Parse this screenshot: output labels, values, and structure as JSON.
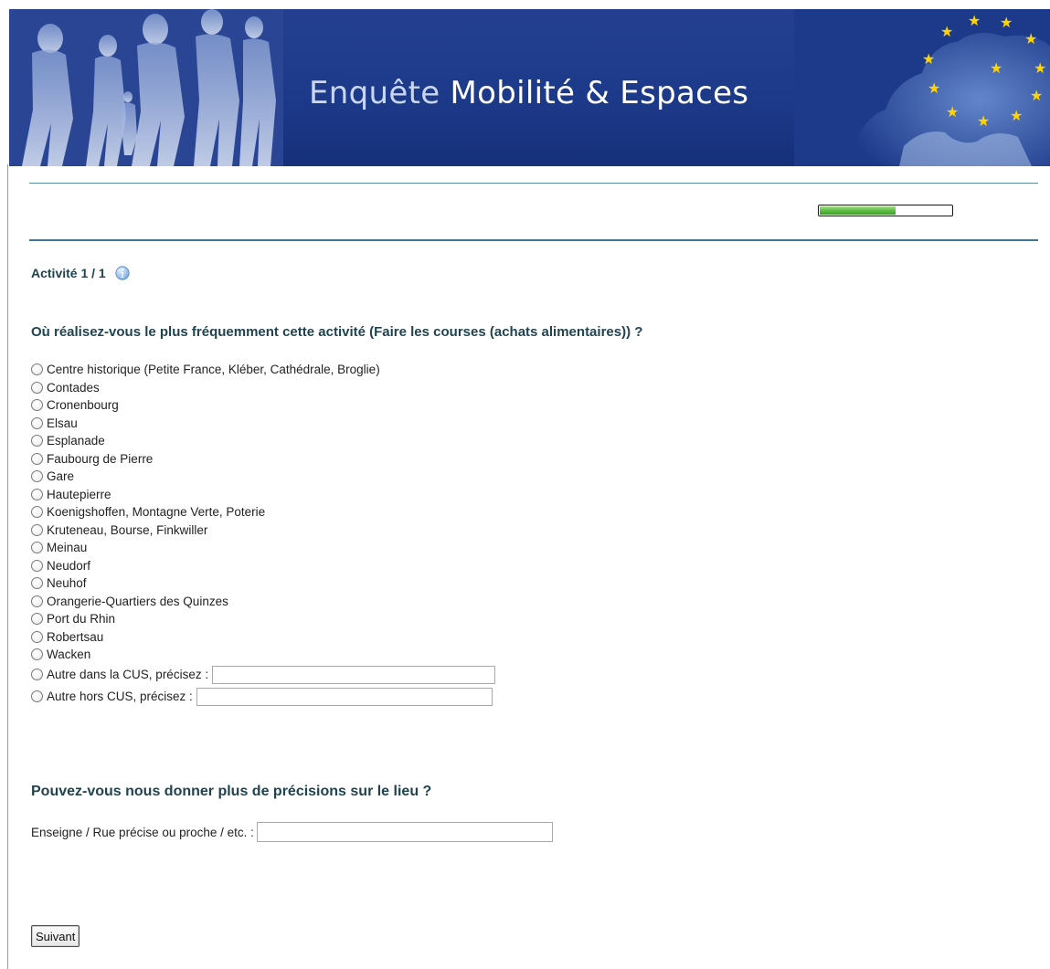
{
  "banner": {
    "title_prefix": "Enquête ",
    "title_main": "Mobilité & Espaces"
  },
  "progress": {
    "fraction": 0.58,
    "fill_color": "#5fbd45"
  },
  "activity": {
    "label": "Activité 1 / 1",
    "help_icon": "info-icon"
  },
  "question1": {
    "text": "Où réalisez-vous le plus fréquemment cette activité (Faire les courses (achats alimentaires)) ?",
    "options": [
      "Centre historique (Petite France, Kléber, Cathédrale, Broglie)",
      "Contades",
      "Cronenbourg",
      "Elsau",
      "Esplanade",
      "Faubourg de Pierre",
      "Gare",
      "Hautepierre",
      "Koenigshoffen, Montagne Verte, Poterie",
      "Kruteneau, Bourse, Finkwiller",
      "Meinau",
      "Neudorf",
      "Neuhof",
      "Orangerie-Quartiers des Quinzes",
      "Port du Rhin",
      "Robertsau",
      "Wacken"
    ],
    "other_options": [
      {
        "label": "Autre dans la CUS, précisez :",
        "value": ""
      },
      {
        "label": "Autre hors CUS, précisez :",
        "value": ""
      }
    ]
  },
  "question2": {
    "text": "Pouvez-vous nous donner plus de précisions sur le lieu ?",
    "field_label": "Enseigne / Rue précise ou proche / etc. :",
    "field_value": ""
  },
  "buttons": {
    "next": "Suivant"
  },
  "colors": {
    "banner_blue": "#1d3a8a",
    "heading_teal": "#20444f",
    "rule_teal": "#3f7890"
  }
}
